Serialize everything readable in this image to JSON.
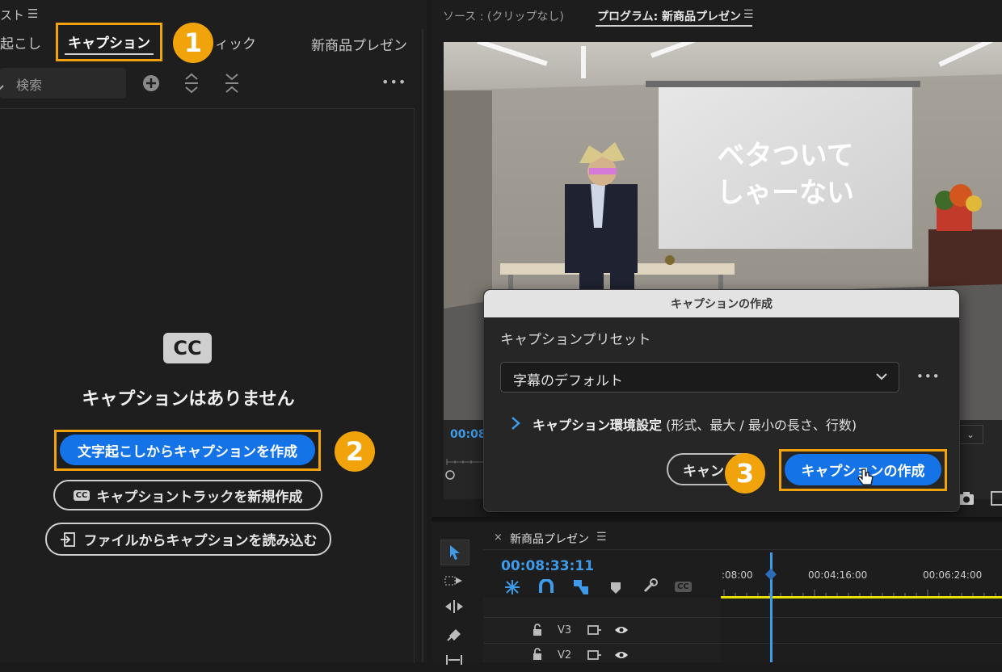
{
  "left_panel": {
    "title_fragment": "スト",
    "menu_icon": "hamburger-icon",
    "tabs": [
      {
        "label": "起こし"
      },
      {
        "label": "キャプション"
      },
      {
        "label": "ィック"
      }
    ],
    "sequence_name": "新商品プレゼン",
    "search_placeholder": "検索",
    "more": "•••",
    "cc_badge": "CC",
    "empty_title": "キャプションはありません",
    "btn_from_transcript": "文字起こしからキャプションを作成",
    "btn_new_track": "キャプショントラックを新規作成",
    "btn_import_file": "ファイルからキャプションを読み込む"
  },
  "badges": [
    "1",
    "2",
    "3"
  ],
  "monitors": {
    "source_label": "ソース : (クリップなし)",
    "program_label": "プログラム: 新商品プレゼン",
    "timecode": "00:08",
    "screen_text_line1": "ベタついて",
    "screen_text_line2": "しゃーない"
  },
  "dialog": {
    "title": "キャプションの作成",
    "preset_label": "キャプションプリセット",
    "preset_value": "字幕のデフォルト",
    "more": "•••",
    "settings_bold": "キャプション環境設定",
    "settings_rest": " (形式、最大 / 最小の長さ、行数)",
    "cancel_label": "キャン",
    "create_label": "キャプションの作成"
  },
  "timeline": {
    "close": "×",
    "sequence_name": "新商品プレゼン",
    "timecode": "00:08:33:11",
    "ruler": [
      ":08:00",
      "00:04:16:00",
      "00:06:24:00"
    ],
    "tracks": [
      "V3",
      "V2"
    ],
    "cc_toggle": "CC"
  },
  "colors": {
    "accent_orange": "#f0a30a",
    "accent_blue": "#1473e6",
    "timecode_blue": "#3d9be9"
  }
}
